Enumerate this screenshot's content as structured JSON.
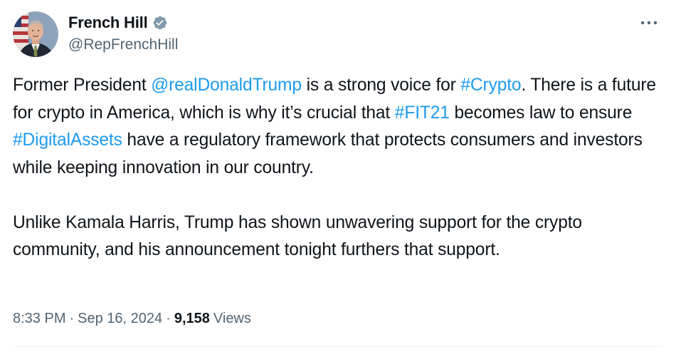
{
  "author": {
    "display_name": "French Hill",
    "handle": "@RepFrenchHill",
    "verified_color": "#829aab"
  },
  "post": {
    "paragraph1": [
      {
        "text": "Former President ",
        "link": false
      },
      {
        "text": "@realDonaldTrump",
        "link": true
      },
      {
        "text": " is a strong voice for ",
        "link": false
      },
      {
        "text": "#Crypto",
        "link": true
      },
      {
        "text": ". There is a future for crypto in America, which is why it’s crucial that ",
        "link": false
      },
      {
        "text": "#FIT21",
        "link": true
      },
      {
        "text": " becomes law to ensure ",
        "link": false
      },
      {
        "text": "#DigitalAssets",
        "link": true
      },
      {
        "text": " have a regulatory framework that protects consumers and investors while keeping innovation in our country.",
        "link": false
      }
    ],
    "paragraph2": "Unlike Kamala Harris, Trump has shown unwavering support for the crypto community, and his announcement tonight furthers that support."
  },
  "meta": {
    "time": "8:33 PM",
    "separator": "·",
    "date": "Sep 16, 2024",
    "views_count": "9,158",
    "views_label": "Views"
  },
  "icons": {
    "more": "more-horizontal-icon",
    "verified": "verified-badge-icon"
  },
  "colors": {
    "link": "#1d9bf0",
    "text": "#0f1419",
    "secondary": "#536471"
  }
}
